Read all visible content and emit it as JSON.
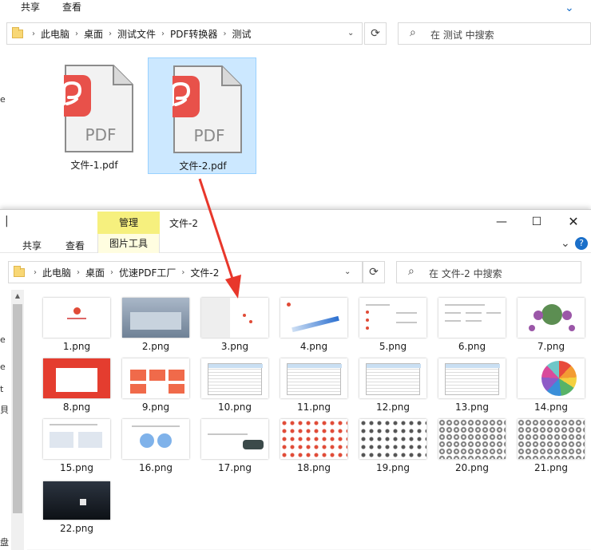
{
  "back_window": {
    "ribbon_tabs": [
      "共享",
      "查看"
    ],
    "address": [
      "此电脑",
      "桌面",
      "测试文件",
      "PDF转换器",
      "测试"
    ],
    "search_placeholder": "在 测试 中搜索",
    "files": [
      {
        "name": "文件-1.pdf",
        "selected": false
      },
      {
        "name": "文件-2.pdf",
        "selected": true
      }
    ],
    "pdf_badge": "PDF"
  },
  "front_window": {
    "title": "文件-2",
    "context_tab": "管理",
    "ribbon_tabs": [
      "共享",
      "查看",
      "图片工具"
    ],
    "address": [
      "此电脑",
      "桌面",
      "优速PDF工厂",
      "文件-2"
    ],
    "search_placeholder": "在 文件-2 中搜索",
    "files": [
      "1.png",
      "2.png",
      "3.png",
      "4.png",
      "5.png",
      "6.png",
      "7.png",
      "8.png",
      "9.png",
      "10.png",
      "11.png",
      "12.png",
      "13.png",
      "14.png",
      "15.png",
      "16.png",
      "17.png",
      "18.png",
      "19.png",
      "20.png",
      "21.png",
      "22.png"
    ],
    "left_pane_glyphs": [
      "e",
      "e",
      "t",
      "貝",
      "盘 (I"
    ]
  },
  "colors": {
    "selection": "#cce8ff",
    "context_tab": "#f6f07e",
    "pdf_red": "#e8514a",
    "arrow": "#e8372b"
  },
  "icons": {
    "folder": "folder-icon",
    "refresh": "refresh-icon",
    "search": "search-icon",
    "minimize": "minimize-icon",
    "maximize": "maximize-icon",
    "close": "close-icon"
  }
}
